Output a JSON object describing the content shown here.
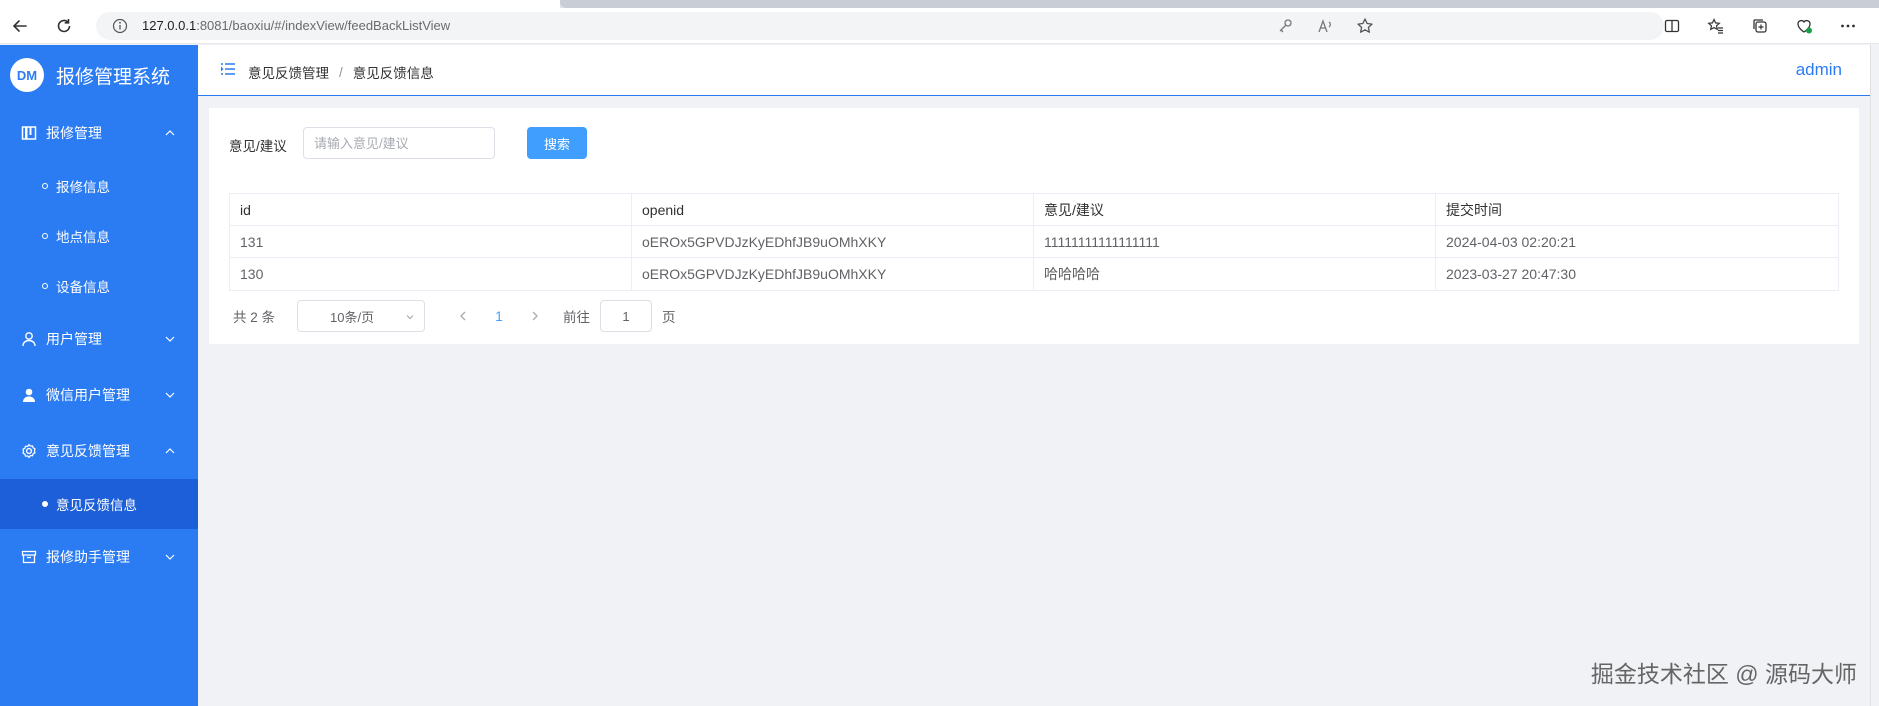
{
  "browser": {
    "url_host": "127.0.0.1",
    "url_rest": ":8081/baoxiu/#/indexView/feedBackListView"
  },
  "sidebar": {
    "logo": "DM",
    "title": "报修管理系统",
    "menus": [
      {
        "label": "报修管理",
        "icon": "book-icon",
        "expanded": true,
        "children": [
          {
            "label": "报修信息"
          },
          {
            "label": "地点信息"
          },
          {
            "label": "设备信息"
          }
        ]
      },
      {
        "label": "用户管理",
        "icon": "user-icon",
        "expanded": false
      },
      {
        "label": "微信用户管理",
        "icon": "user-filled-icon",
        "expanded": false
      },
      {
        "label": "意见反馈管理",
        "icon": "gear-icon",
        "expanded": true,
        "children": [
          {
            "label": "意见反馈信息",
            "active": true
          }
        ]
      },
      {
        "label": "报修助手管理",
        "icon": "box-icon",
        "expanded": false
      }
    ]
  },
  "header": {
    "breadcrumb": [
      "意见反馈管理",
      "意见反馈信息"
    ],
    "breadcrumb_sep": "/",
    "user": "admin"
  },
  "search": {
    "label": "意见/建议",
    "placeholder": "请输入意见/建议",
    "button": "搜索"
  },
  "table": {
    "columns": [
      "id",
      "openid",
      "意见/建议",
      "提交时间"
    ],
    "rows": [
      [
        "131",
        "oEROx5GPVDJzKyEDhfJB9uOMhXKY",
        "11111111111111111",
        "2024-04-03 02:20:21"
      ],
      [
        "130",
        "oEROx5GPVDJzKyEDhfJB9uOMhXKY",
        "哈哈哈哈",
        "2023-03-27 20:47:30"
      ]
    ]
  },
  "pagination": {
    "total": "共 2 条",
    "page_size": "10条/页",
    "current_page": "1",
    "goto_label": "前往",
    "goto_value": "1",
    "page_unit": "页"
  },
  "watermark": "掘金技术社区 @ 源码大师",
  "colors": {
    "sidebar": "#2b7cf3",
    "sidebar_active": "#1d5fd8",
    "primary": "#409eff"
  }
}
